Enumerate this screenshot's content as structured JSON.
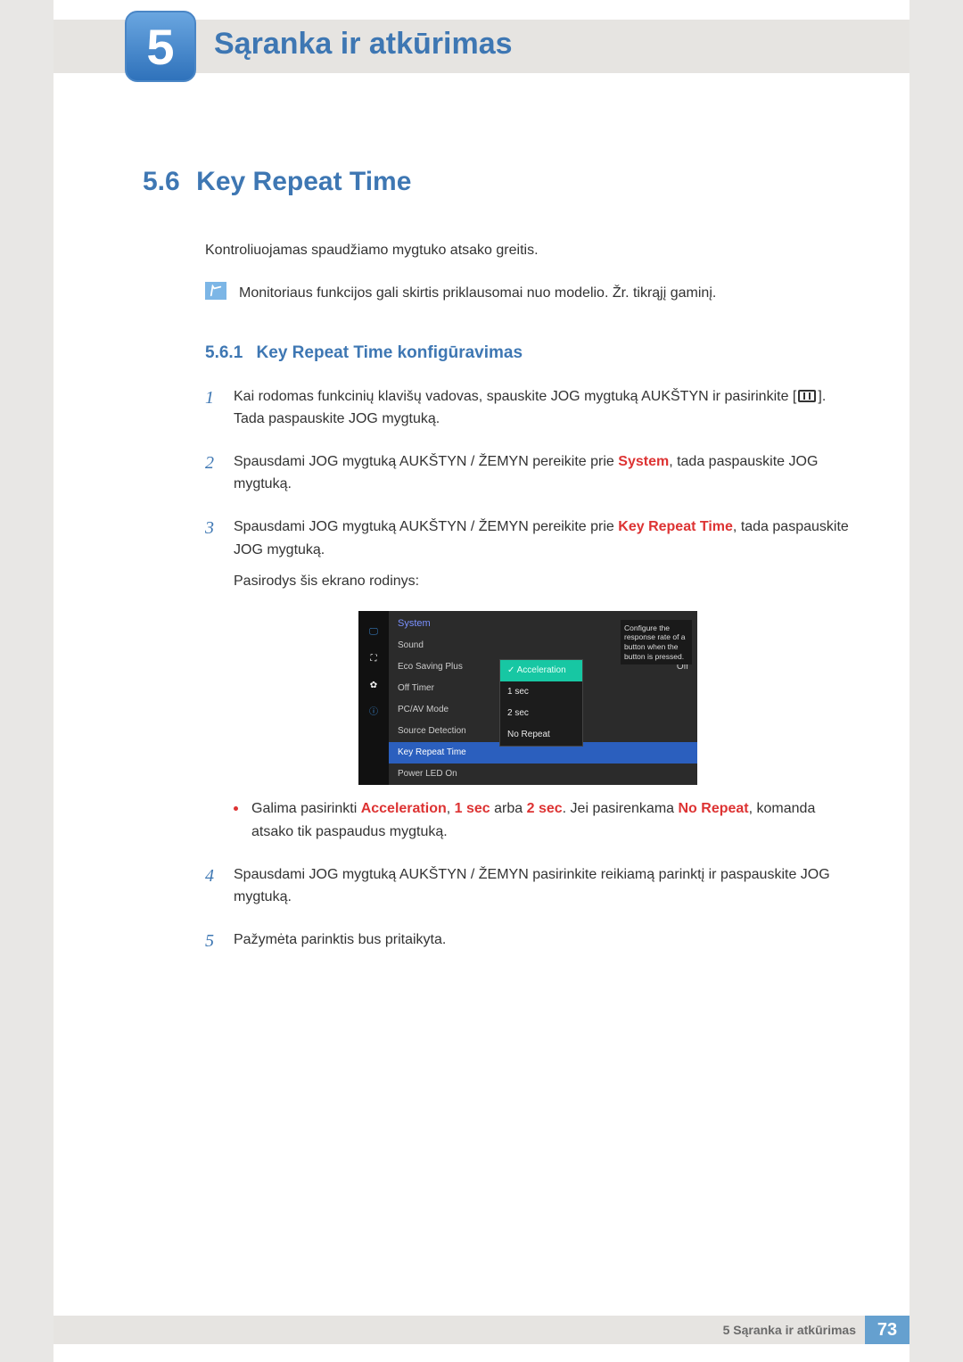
{
  "chapter": {
    "number": "5",
    "title": "Sąranka ir atkūrimas"
  },
  "section": {
    "number": "5.6",
    "title": "Key Repeat Time"
  },
  "intro": "Kontroliuojamas spaudžiamo mygtuko atsako greitis.",
  "note": "Monitoriaus funkcijos gali skirtis priklausomai nuo modelio. Žr. tikrąjį gaminį.",
  "subsection": {
    "number": "5.6.1",
    "title": "Key Repeat Time konfigūravimas"
  },
  "steps": {
    "s1a": "Kai rodomas funkcinių klavišų vadovas, spauskite JOG mygtuką AUKŠTYN ir pasirinkite [",
    "s1b": "]. Tada paspauskite JOG mygtuką.",
    "s2a": "Spausdami JOG mygtuką AUKŠTYN / ŽEMYN pereikite prie ",
    "s2hl": "System",
    "s2b": ", tada paspauskite JOG mygtuką.",
    "s3a": "Spausdami JOG mygtuką AUKŠTYN / ŽEMYN pereikite prie ",
    "s3hl": "Key Repeat Time",
    "s3b": ", tada paspauskite JOG mygtuką.",
    "s3c": "Pasirodys šis ekrano rodinys:",
    "bullet_a": "Galima pasirinkti ",
    "bullet_h1": "Acceleration",
    "bullet_sep": ", ",
    "bullet_h2": "1 sec",
    "bullet_or": " arba ",
    "bullet_h3": "2 sec",
    "bullet_b": ". Jei pasirenkama ",
    "bullet_h4": "No Repeat",
    "bullet_c": ", komanda atsako tik paspaudus mygtuką.",
    "s4": "Spausdami JOG mygtuką AUKŠTYN / ŽEMYN pasirinkite reikiamą parinktį ir paspauskite JOG mygtuką.",
    "s5": "Pažymėta parinktis bus pritaikyta."
  },
  "osd": {
    "title": "System",
    "items": {
      "sound": "Sound",
      "eco": "Eco Saving Plus",
      "eco_val": "Off",
      "offtimer": "Off Timer",
      "pcav": "PC/AV Mode",
      "source": "Source Detection",
      "keyrepeat": "Key Repeat Time",
      "powerled": "Power LED On"
    },
    "tip": "Configure the response rate of a button when the button is pressed.",
    "options": {
      "acc": "Acceleration",
      "s1": "1 sec",
      "s2": "2 sec",
      "nr": "No Repeat"
    }
  },
  "footer": {
    "label": "5 Sąranka ir atkūrimas",
    "page": "73"
  }
}
